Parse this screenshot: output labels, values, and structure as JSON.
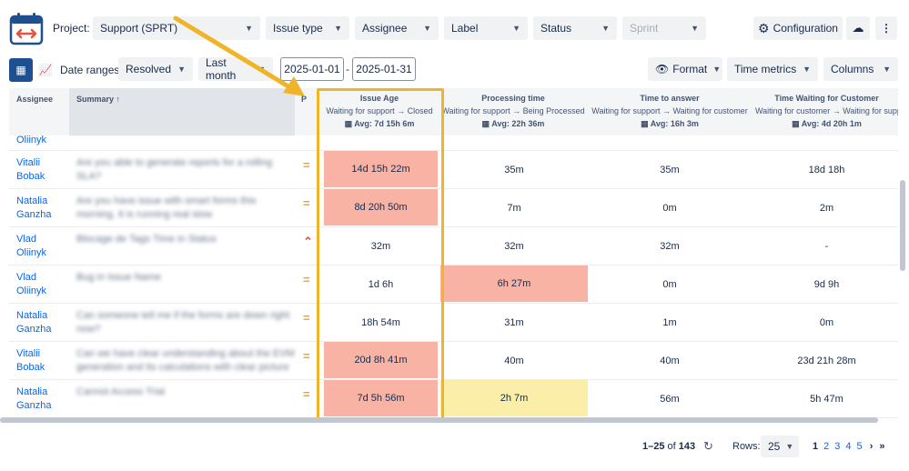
{
  "toolbar": {
    "project_label": "Project:",
    "project_value": "Support (SPRT)",
    "filters": [
      "Issue type",
      "Assignee",
      "Label",
      "Status",
      "Sprint"
    ],
    "configuration_label": "Configuration"
  },
  "toolbar2": {
    "date_ranges_label": "Date ranges:",
    "resolved_value": "Resolved",
    "last_month_value": "Last month",
    "date_from": "2025-01-01",
    "date_sep": "-",
    "date_to": "2025-01-31",
    "format_label": "Format",
    "time_metrics_label": "Time metrics",
    "columns_label": "Columns"
  },
  "table": {
    "headers": {
      "assignee": "Assignee",
      "summary": "Summary ↑",
      "p": "P",
      "issue_age": {
        "title": "Issue Age",
        "sub": "Waiting for support → Closed",
        "avg": "Avg: 7d 15h 6m"
      },
      "processing": {
        "title": "Processing time",
        "sub": "Waiting for support → Being Processed",
        "avg": "Avg: 22h 36m"
      },
      "time_to_answer": {
        "title": "Time to answer",
        "sub": "Waiting for support → Waiting for customer",
        "avg": "Avg: 16h 3m"
      },
      "waiting_customer": {
        "title": "Time Waiting for Customer",
        "sub": "Waiting for customer → Waiting for supp",
        "avg": "Avg: 4d 20h 1m"
      }
    },
    "partial_row_name": "Oliinyk",
    "rows": [
      {
        "name1": "Vitalii",
        "name2": "Bobak",
        "summary1": "Are you able to generate reports for a rolling",
        "summary2": "SLA?",
        "age": "14d 15h 22m",
        "proc": "35m",
        "answer": "35m",
        "wait": "18d 18h"
      },
      {
        "name1": "Natalia",
        "name2": "Ganzha",
        "summary1": "Are you have issue with smart forms this",
        "summary2": "morning. It is running real slow",
        "age": "8d 20h 50m",
        "proc": "7m",
        "answer": "0m",
        "wait": "2m"
      },
      {
        "name1": "Vlad",
        "name2": "Oliinyk",
        "summary1": "Blocage de Tags Time in Status",
        "summary2": "",
        "age": "32m",
        "proc": "32m",
        "answer": "32m",
        "wait": "-"
      },
      {
        "name1": "Vlad",
        "name2": "Oliinyk",
        "summary1": "Bug in Issue Name",
        "summary2": "",
        "age": "1d 6h",
        "proc": "6h 27m",
        "answer": "0m",
        "wait": "9d 9h"
      },
      {
        "name1": "Natalia",
        "name2": "Ganzha",
        "summary1": "Can someone tell me if the forms are down right",
        "summary2": "now?",
        "age": "18h 54m",
        "proc": "31m",
        "answer": "1m",
        "wait": "0m"
      },
      {
        "name1": "Vitalii",
        "name2": "Bobak",
        "summary1": "Can we have clear understanding about the EVM",
        "summary2": "generation and its calculations with clear picture",
        "age": "20d 8h 41m",
        "proc": "40m",
        "answer": "40m",
        "wait": "23d 21h 28m"
      },
      {
        "name1": "Natalia",
        "name2": "Ganzha",
        "summary1": "Cannot Access Trial",
        "summary2": "",
        "age": "7d 5h 56m",
        "proc": "2h 7m",
        "answer": "56m",
        "wait": "5h 47m"
      }
    ]
  },
  "pagination": {
    "range": "1–25",
    "of_label": "of",
    "total": "143",
    "rows_label": "Rows:",
    "rows_value": "25",
    "pages": [
      "1",
      "2",
      "3",
      "4",
      "5"
    ]
  },
  "colors": {
    "highlight_arrow": "#f0b429",
    "cell_red": "#f8b3a5",
    "cell_yellow": "#fbeea8",
    "link": "#0c66e4"
  }
}
